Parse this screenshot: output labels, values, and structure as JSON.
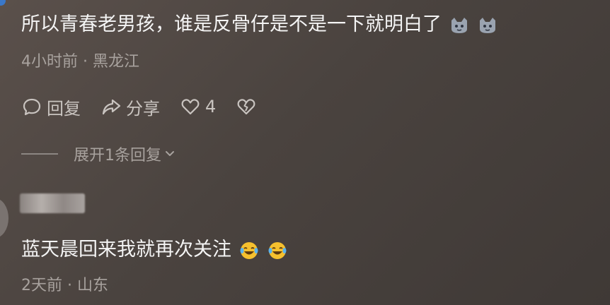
{
  "comment1": {
    "text": "所以青春老男孩，谁是反骨仔是不是一下就明白了",
    "emojis": [
      "cat-face-emoji",
      "cat-face-emoji"
    ],
    "time": "4小时前",
    "location": "黑龙江",
    "separator": "·",
    "actions": {
      "reply_label": "回复",
      "share_label": "分享",
      "like_count": "4"
    },
    "expand_label": "展开1条回复"
  },
  "comment2": {
    "text": "蓝天晨回来我就再次关注",
    "emojis": [
      "laughing-tears-emoji",
      "laughing-tears-emoji"
    ],
    "time": "2天前",
    "location": "山东",
    "separator": "·"
  }
}
